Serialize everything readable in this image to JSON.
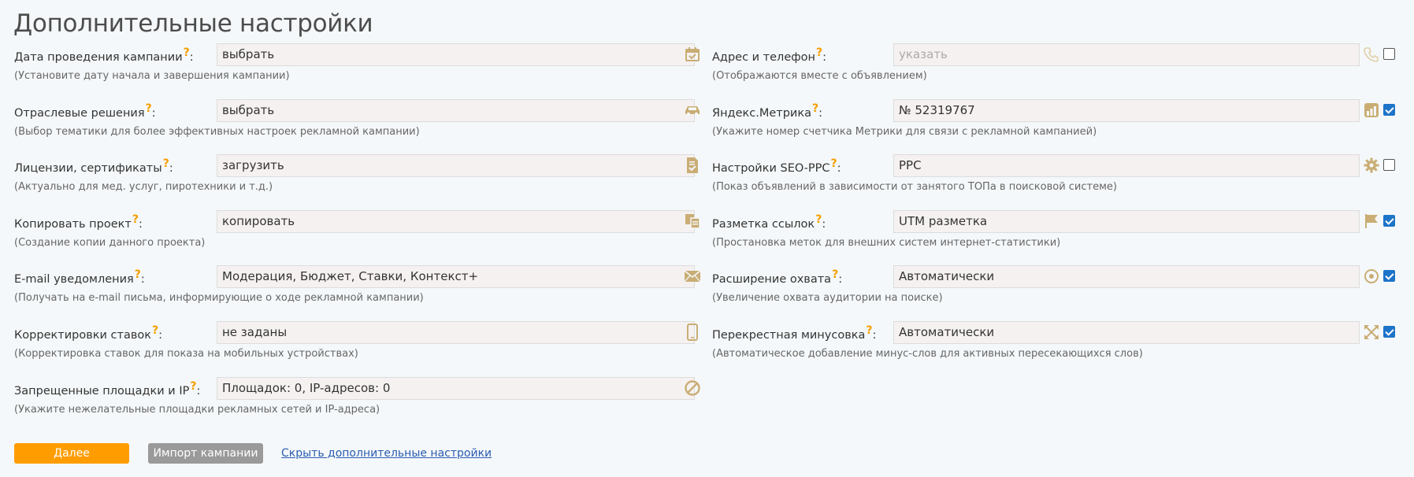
{
  "title": "Дополнительные настройки",
  "left": [
    {
      "label": "Дата проведения кампании",
      "hint": "(Установите дату начала и завершения кампании)",
      "value": "выбрать",
      "icon": "calendar-icon"
    },
    {
      "label": "Отраслевые решения",
      "hint": "(Выбор тематики для более эффективных настроек рекламной кампании)",
      "value": "выбрать",
      "icon": "car-icon"
    },
    {
      "label": "Лицензии, сертификаты",
      "hint": "(Актуально для мед. услуг, пиротехники и т.д.)",
      "value": "загрузить",
      "icon": "document-check-icon"
    },
    {
      "label": "Копировать проект",
      "hint": "(Создание копии данного проекта)",
      "value": "копировать",
      "icon": "copy-icon"
    },
    {
      "label": "E-mail уведомления",
      "hint": "(Получать на e-mail письма, информирующие о ходе рекламной кампании)",
      "value": "Модерация, Бюджет, Ставки, Контекст+",
      "icon": "envelope-icon"
    },
    {
      "label": "Корректировки ставок",
      "hint": "(Корректировка ставок для показа на мобильных устройствах)",
      "value": "не заданы",
      "icon": "mobile-icon"
    },
    {
      "label": "Запрещенные площадки и IP",
      "hint": "(Укажите нежелательные площадки рекламных сетей и IP-адреса)",
      "value": "Площадок: 0, IP-адресов: 0",
      "icon": "ban-icon"
    }
  ],
  "right": [
    {
      "label": "Адрес и телефон",
      "hint": "(Отображаются вместе с объявлением)",
      "placeholder": "указать",
      "value": "",
      "icon": "phone-icon",
      "checked": false
    },
    {
      "label": "Яндекс.Метрика",
      "hint": "(Укажите номер счетчика Метрики для связи с рекламной кампанией)",
      "value": "№ 52319767",
      "icon": "metrika-icon",
      "checked": true
    },
    {
      "label": "Настройки SEO-PPC",
      "hint": "(Показ объявлений в зависимости от занятого ТОПа в поисковой системе)",
      "value": "PPC",
      "icon": "gear-icon",
      "checked": false
    },
    {
      "label": "Разметка ссылок",
      "hint": "(Простановка меток для внешних систем интернет-статистики)",
      "value": "UTM разметка",
      "icon": "flag-icon",
      "checked": true
    },
    {
      "label": "Расширение охвата",
      "hint": "(Увеличение охвата аудитории на поиске)",
      "value": "Автоматически",
      "icon": "target-icon",
      "checked": true
    },
    {
      "label": "Перекрестная минусовка",
      "hint": "(Автоматическое добавление минус-слов для активных пересекающихся слов)",
      "value": "Автоматически",
      "icon": "cross-arrows-icon",
      "checked": true
    }
  ],
  "qmark": "?",
  "colon": ":",
  "buttons": {
    "next": "Далее",
    "import": "Импорт кампании",
    "hide": "Скрыть дополнительные настройки"
  },
  "colors": {
    "accent": "#ff9d00",
    "icon": "#c9ad74",
    "checkbox": "#1d74c9",
    "link": "#2a5db0"
  }
}
